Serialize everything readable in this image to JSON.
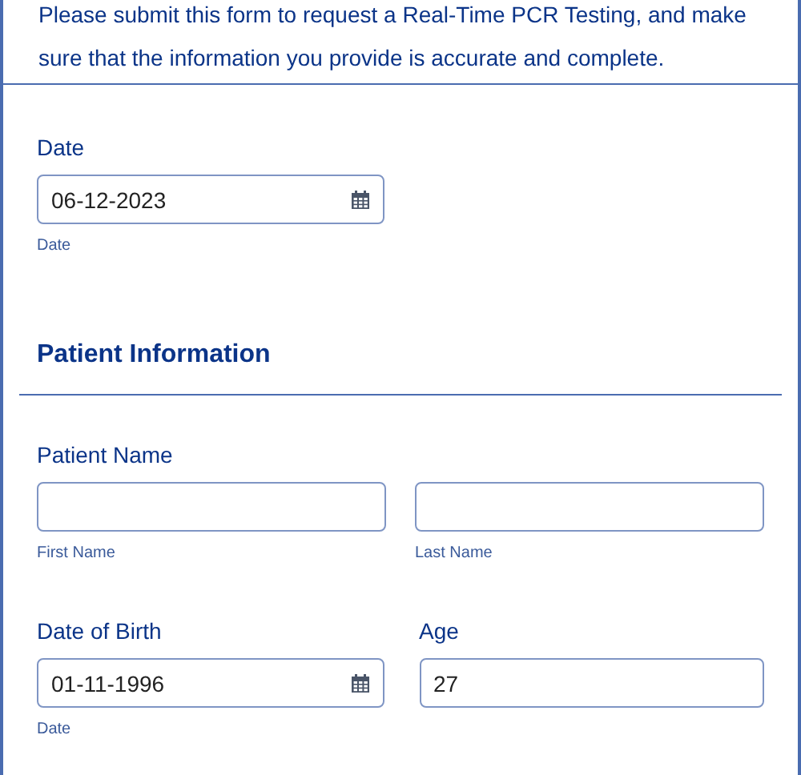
{
  "intro": "Please submit this form to request a Real-Time PCR Testing, and make sure that the information you provide is accurate and complete.",
  "date": {
    "label": "Date",
    "value": "06-12-2023",
    "sublabel": "Date"
  },
  "section": {
    "title": "Patient Information"
  },
  "patient_name": {
    "label": "Patient Name",
    "fields": [
      {
        "sublabel": "First Name"
      },
      {
        "sublabel": "Last Name"
      }
    ]
  },
  "date_of_birth": {
    "label": "Date of Birth",
    "value": "01-11-1996",
    "sublabel": "Date"
  },
  "age": {
    "label": "Age",
    "value": "27"
  }
}
